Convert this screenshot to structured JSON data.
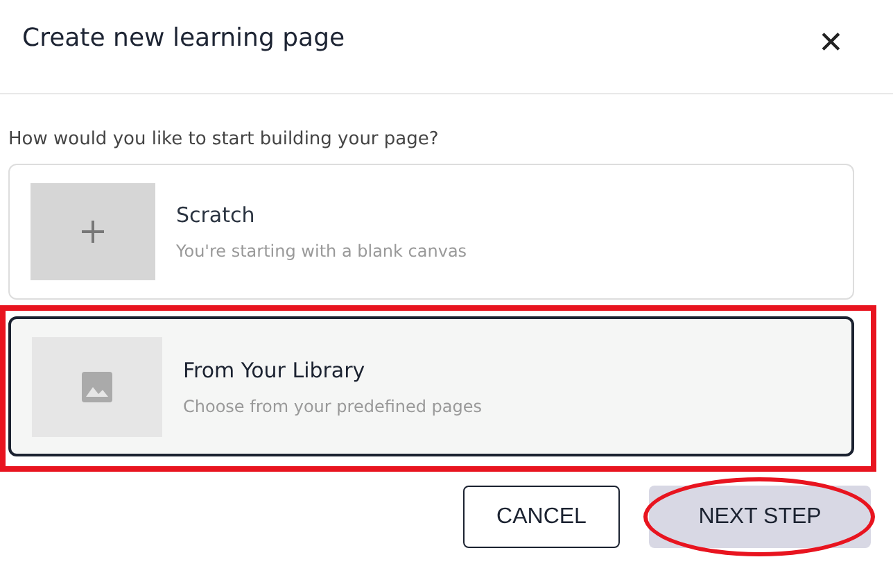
{
  "dialog": {
    "title": "Create new learning page",
    "close": "✕"
  },
  "question": "How would you like to start building your page?",
  "options": [
    {
      "kind": "blank",
      "title": "Scratch",
      "description": "You're starting with a blank canvas",
      "selected": false,
      "highlighted": false
    },
    {
      "kind": "library",
      "title": "From Your Library",
      "description": "Choose from your predefined pages",
      "selected": true,
      "highlighted": true
    }
  ],
  "buttons": [
    {
      "kind": "secondary",
      "label": "CANCEL",
      "circled": false
    },
    {
      "kind": "primary",
      "label": "NEXT STEP",
      "circled": true
    }
  ]
}
